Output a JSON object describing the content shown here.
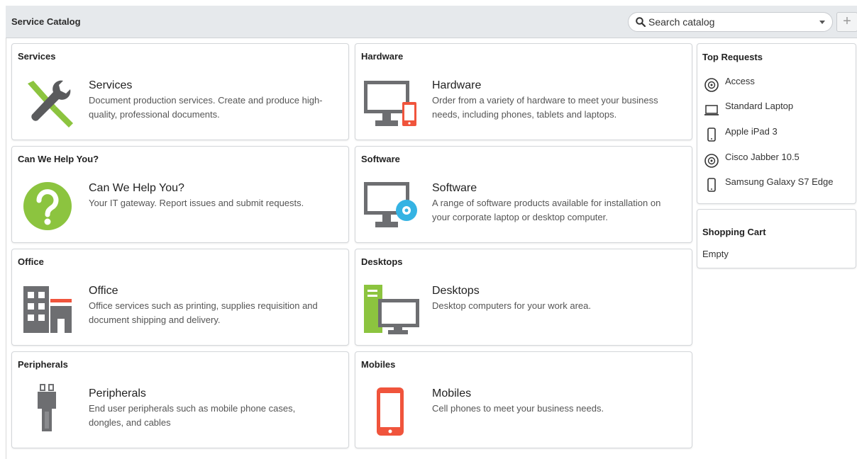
{
  "header": {
    "title": "Service Catalog",
    "search_placeholder": "Search catalog",
    "add_label": "+"
  },
  "categories": [
    {
      "id": "services",
      "header": "Services",
      "title": "Services",
      "description": "Document production services. Create and produce high-quality, professional documents.",
      "icon": "tools-icon"
    },
    {
      "id": "hardware",
      "header": "Hardware",
      "title": "Hardware",
      "description": "Order from a variety of hardware to meet your business needs, including phones, tablets and laptops.",
      "icon": "monitor-phone-icon"
    },
    {
      "id": "help",
      "header": "Can We Help You?",
      "title": "Can We Help You?",
      "description": "Your IT gateway. Report issues and submit requests.",
      "icon": "question-icon"
    },
    {
      "id": "software",
      "header": "Software",
      "title": "Software",
      "description": "A range of software products available for installation on your corporate laptop or desktop computer.",
      "icon": "monitor-disc-icon"
    },
    {
      "id": "office",
      "header": "Office",
      "title": "Office",
      "description": "Office services such as printing, supplies requisition and document shipping and delivery.",
      "icon": "building-icon"
    },
    {
      "id": "desktops",
      "header": "Desktops",
      "title": "Desktops",
      "description": "Desktop computers for your work area.",
      "icon": "desktop-tower-icon"
    },
    {
      "id": "peripherals",
      "header": "Peripherals",
      "title": "Peripherals",
      "description": "End user peripherals such as mobile phone cases, dongles, and cables",
      "icon": "plug-icon"
    },
    {
      "id": "mobiles",
      "header": "Mobiles",
      "title": "Mobiles",
      "description": "Cell phones to meet your business needs.",
      "icon": "mobile-phone-icon"
    }
  ],
  "top_requests": {
    "title": "Top Requests",
    "items": [
      {
        "label": "Access",
        "icon": "disc-icon"
      },
      {
        "label": "Standard Laptop",
        "icon": "laptop-icon"
      },
      {
        "label": "Apple iPad 3",
        "icon": "phone-icon"
      },
      {
        "label": "Cisco Jabber 10.5",
        "icon": "disc-icon"
      },
      {
        "label": "Samsung Galaxy S7 Edge",
        "icon": "phone-icon"
      }
    ]
  },
  "shopping_cart": {
    "title": "Shopping Cart",
    "status": "Empty"
  },
  "colors": {
    "green": "#8cc43f",
    "gray": "#6d6e71",
    "red": "#f0543c",
    "blue": "#35b3e3",
    "header_bg": "#e6e9ec"
  }
}
